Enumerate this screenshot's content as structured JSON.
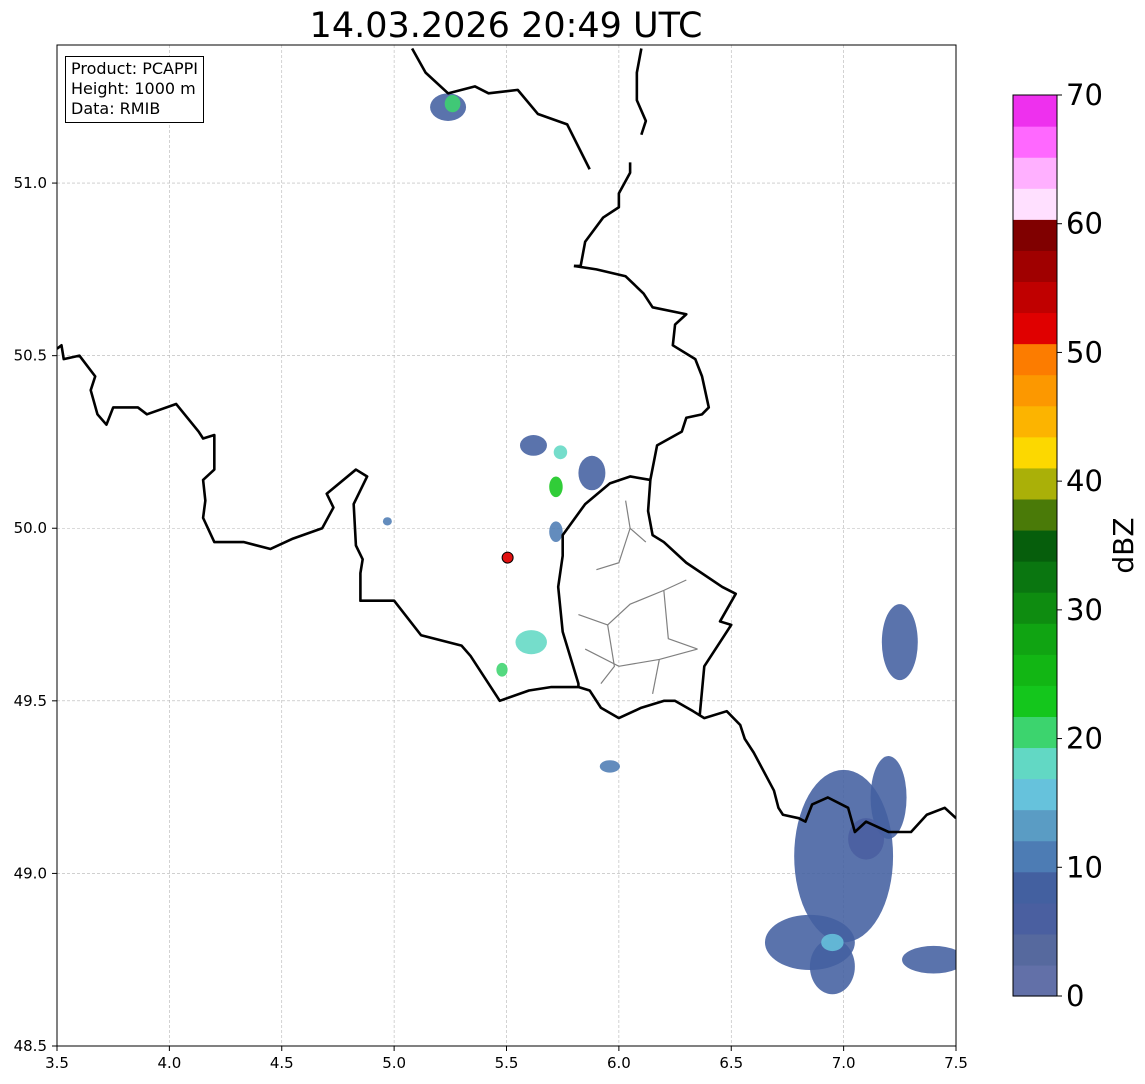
{
  "title": "14.03.2026 20:49 UTC",
  "info": {
    "product": "Product: PCAPPI",
    "height": "Height: 1000 m",
    "data": "Data: RMIB"
  },
  "axes": {
    "x_ticks": [
      "3.5",
      "4.0",
      "4.5",
      "5.0",
      "5.5",
      "6.0",
      "6.5",
      "7.0",
      "7.5"
    ],
    "y_ticks": [
      "48.5",
      "49.0",
      "49.5",
      "50.0",
      "50.5",
      "51.0"
    ],
    "xlim": [
      3.5,
      7.5
    ],
    "ylim": [
      48.5,
      51.4
    ],
    "grid": true
  },
  "radar_site": {
    "lon": 5.505,
    "lat": 49.915,
    "color": "#e01010"
  },
  "colorbar": {
    "label": "dBZ",
    "ticks": [
      "0",
      "10",
      "20",
      "30",
      "40",
      "50",
      "60",
      "70"
    ],
    "range": [
      0,
      70
    ],
    "colors": [
      "#6270a8",
      "#56699e",
      "#4a5fa0",
      "#4360a0",
      "#4d7cb4",
      "#5a9cc4",
      "#66c2dc",
      "#62d8c4",
      "#3cd46e",
      "#14c61c",
      "#12b614",
      "#10a412",
      "#0e8c10",
      "#0a7610",
      "#065e0c",
      "#4a7a08",
      "#aab008",
      "#fcd800",
      "#fcb400",
      "#fc9800",
      "#fc7c00",
      "#e00000",
      "#c00000",
      "#a00000",
      "#800000",
      "#ffe0ff",
      "#ffb0ff",
      "#ff68ff",
      "#ee30ee"
    ]
  },
  "echoes": [
    {
      "lon": 5.24,
      "lat": 51.22,
      "rx": 0.08,
      "ry": 0.04,
      "level": 8
    },
    {
      "lon": 5.26,
      "lat": 51.23,
      "rx": 0.035,
      "ry": 0.025,
      "level": 20
    },
    {
      "lon": 5.62,
      "lat": 50.24,
      "rx": 0.06,
      "ry": 0.03,
      "level": 8
    },
    {
      "lon": 5.74,
      "lat": 50.22,
      "rx": 0.03,
      "ry": 0.02,
      "level": 18
    },
    {
      "lon": 5.72,
      "lat": 50.12,
      "rx": 0.03,
      "ry": 0.03,
      "level": 22
    },
    {
      "lon": 5.88,
      "lat": 50.16,
      "rx": 0.06,
      "ry": 0.05,
      "level": 8
    },
    {
      "lon": 5.72,
      "lat": 49.99,
      "rx": 0.03,
      "ry": 0.03,
      "level": 9
    },
    {
      "lon": 4.97,
      "lat": 50.02,
      "rx": 0.02,
      "ry": 0.012,
      "level": 10
    },
    {
      "lon": 5.61,
      "lat": 49.67,
      "rx": 0.07,
      "ry": 0.035,
      "level": 18
    },
    {
      "lon": 5.48,
      "lat": 49.59,
      "rx": 0.025,
      "ry": 0.02,
      "level": 20
    },
    {
      "lon": 5.96,
      "lat": 49.31,
      "rx": 0.045,
      "ry": 0.018,
      "level": 9
    },
    {
      "lon": 7.25,
      "lat": 49.67,
      "rx": 0.08,
      "ry": 0.11,
      "level": 7
    },
    {
      "lon": 7.0,
      "lat": 49.05,
      "rx": 0.22,
      "ry": 0.25,
      "level": 7
    },
    {
      "lon": 6.85,
      "lat": 48.8,
      "rx": 0.2,
      "ry": 0.08,
      "level": 7
    },
    {
      "lon": 6.95,
      "lat": 48.73,
      "rx": 0.1,
      "ry": 0.08,
      "level": 7
    },
    {
      "lon": 7.2,
      "lat": 49.22,
      "rx": 0.08,
      "ry": 0.12,
      "level": 7
    },
    {
      "lon": 6.95,
      "lat": 48.8,
      "rx": 0.05,
      "ry": 0.025,
      "level": 15
    },
    {
      "lon": 7.4,
      "lat": 48.75,
      "rx": 0.14,
      "ry": 0.04,
      "level": 7
    },
    {
      "lon": 7.1,
      "lat": 49.1,
      "rx": 0.08,
      "ry": 0.06,
      "level": 6
    }
  ],
  "borders": [
    [
      [
        3.5,
        50.52
      ],
      [
        3.52,
        50.53
      ],
      [
        3.53,
        50.49
      ],
      [
        3.6,
        50.5
      ],
      [
        3.67,
        50.44
      ],
      [
        3.65,
        50.4
      ],
      [
        3.68,
        50.33
      ],
      [
        3.72,
        50.3
      ],
      [
        3.75,
        50.35
      ],
      [
        3.86,
        50.35
      ],
      [
        3.9,
        50.33
      ],
      [
        4.03,
        50.36
      ],
      [
        4.13,
        50.28
      ],
      [
        4.15,
        50.26
      ],
      [
        4.2,
        50.27
      ],
      [
        4.2,
        50.17
      ],
      [
        4.15,
        50.14
      ],
      [
        4.16,
        50.08
      ],
      [
        4.15,
        50.03
      ],
      [
        4.2,
        49.96
      ],
      [
        4.33,
        49.96
      ],
      [
        4.45,
        49.94
      ],
      [
        4.55,
        49.97
      ],
      [
        4.68,
        50.0
      ],
      [
        4.73,
        50.06
      ],
      [
        4.7,
        50.1
      ],
      [
        4.83,
        50.17
      ],
      [
        4.88,
        50.15
      ],
      [
        4.82,
        50.07
      ],
      [
        4.83,
        49.95
      ],
      [
        4.86,
        49.91
      ],
      [
        4.85,
        49.87
      ],
      [
        4.85,
        49.79
      ],
      [
        4.92,
        49.79
      ],
      [
        5.0,
        49.79
      ],
      [
        5.12,
        49.69
      ],
      [
        5.3,
        49.66
      ],
      [
        5.34,
        49.63
      ],
      [
        5.47,
        49.5
      ],
      [
        5.6,
        49.53
      ],
      [
        5.7,
        49.54
      ],
      [
        5.8,
        49.54
      ],
      [
        5.82,
        49.54
      ],
      [
        5.87,
        49.53
      ],
      [
        5.92,
        49.48
      ],
      [
        6.0,
        49.45
      ],
      [
        6.1,
        49.48
      ],
      [
        6.2,
        49.5
      ],
      [
        6.25,
        49.5
      ],
      [
        6.33,
        49.47
      ],
      [
        6.38,
        49.45
      ],
      [
        6.48,
        49.47
      ],
      [
        6.54,
        49.43
      ],
      [
        6.56,
        49.39
      ],
      [
        6.6,
        49.35
      ],
      [
        6.69,
        49.24
      ],
      [
        6.71,
        49.19
      ],
      [
        6.73,
        49.17
      ],
      [
        6.8,
        49.16
      ],
      [
        6.83,
        49.15
      ],
      [
        6.86,
        49.2
      ],
      [
        6.93,
        49.22
      ],
      [
        7.02,
        49.19
      ],
      [
        7.05,
        49.12
      ],
      [
        7.1,
        49.15
      ],
      [
        7.2,
        49.12
      ],
      [
        7.3,
        49.12
      ],
      [
        7.37,
        49.17
      ],
      [
        7.45,
        49.19
      ],
      [
        7.5,
        49.16
      ]
    ],
    [
      [
        5.87,
        51.04
      ],
      [
        5.77,
        51.17
      ],
      [
        5.64,
        51.2
      ],
      [
        5.55,
        51.27
      ],
      [
        5.42,
        51.26
      ],
      [
        5.36,
        51.28
      ],
      [
        5.24,
        51.26
      ],
      [
        5.14,
        51.32
      ],
      [
        5.08,
        51.39
      ]
    ],
    [
      [
        3.59,
        51.3
      ],
      [
        3.7,
        51.31
      ],
      [
        3.82,
        51.34
      ]
    ],
    [
      [
        6.1,
        51.14
      ],
      [
        6.12,
        51.18
      ],
      [
        6.08,
        51.24
      ],
      [
        6.08,
        51.32
      ],
      [
        6.1,
        51.39
      ]
    ],
    [
      [
        5.8,
        50.76
      ],
      [
        5.83,
        50.76
      ],
      [
        5.85,
        50.83
      ],
      [
        5.93,
        50.9
      ],
      [
        6.0,
        50.93
      ],
      [
        6.0,
        50.97
      ],
      [
        6.05,
        51.03
      ],
      [
        6.05,
        51.06
      ]
    ],
    [
      [
        5.8,
        50.76
      ],
      [
        5.9,
        50.75
      ],
      [
        6.03,
        50.73
      ],
      [
        6.11,
        50.68
      ],
      [
        6.15,
        50.64
      ],
      [
        6.3,
        50.62
      ],
      [
        6.25,
        50.59
      ],
      [
        6.24,
        50.53
      ],
      [
        6.34,
        50.49
      ],
      [
        6.37,
        50.44
      ],
      [
        6.4,
        50.35
      ],
      [
        6.37,
        50.33
      ],
      [
        6.3,
        50.32
      ],
      [
        6.28,
        50.28
      ],
      [
        6.17,
        50.24
      ],
      [
        6.14,
        50.14
      ],
      [
        6.05,
        50.15
      ],
      [
        5.96,
        50.13
      ],
      [
        5.85,
        50.07
      ],
      [
        5.75,
        49.98
      ],
      [
        5.75,
        49.92
      ],
      [
        5.73,
        49.83
      ],
      [
        5.75,
        49.7
      ],
      [
        5.82,
        49.55
      ],
      [
        5.82,
        49.54
      ]
    ],
    [
      [
        6.14,
        50.14
      ],
      [
        6.13,
        50.05
      ],
      [
        6.15,
        49.98
      ],
      [
        6.2,
        49.96
      ],
      [
        6.3,
        49.9
      ],
      [
        6.46,
        49.83
      ],
      [
        6.52,
        49.81
      ],
      [
        6.45,
        49.73
      ],
      [
        6.5,
        49.72
      ],
      [
        6.38,
        49.6
      ],
      [
        6.37,
        49.53
      ],
      [
        6.36,
        49.46
      ]
    ]
  ],
  "internal_lines": [
    [
      [
        5.9,
        49.88
      ],
      [
        6.0,
        49.9
      ],
      [
        6.05,
        50.0
      ],
      [
        6.12,
        49.96
      ]
    ],
    [
      [
        5.82,
        49.75
      ],
      [
        5.95,
        49.72
      ],
      [
        6.05,
        49.78
      ],
      [
        6.2,
        49.82
      ],
      [
        6.3,
        49.85
      ]
    ],
    [
      [
        5.85,
        49.65
      ],
      [
        6.0,
        49.6
      ],
      [
        6.18,
        49.62
      ],
      [
        6.35,
        49.65
      ]
    ],
    [
      [
        5.95,
        49.72
      ],
      [
        5.98,
        49.6
      ],
      [
        5.92,
        49.55
      ]
    ],
    [
      [
        6.18,
        49.62
      ],
      [
        6.15,
        49.52
      ]
    ],
    [
      [
        6.2,
        49.82
      ],
      [
        6.22,
        49.68
      ],
      [
        6.35,
        49.65
      ]
    ],
    [
      [
        6.05,
        50.0
      ],
      [
        6.03,
        50.08
      ]
    ]
  ]
}
